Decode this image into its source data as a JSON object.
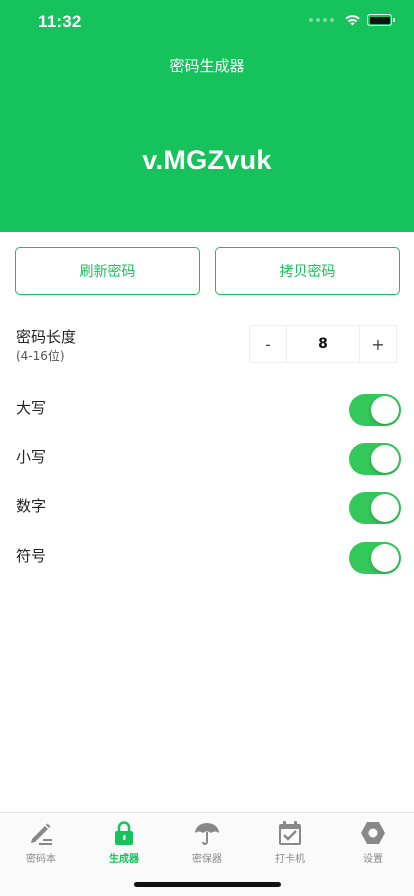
{
  "status_bar": {
    "time": "11:32"
  },
  "header": {
    "title": "密码生成器",
    "password": "v.MGZvuk",
    "bg_color": "#15c25c"
  },
  "actions": {
    "refresh_label": "刷新密码",
    "copy_label": "拷贝密码"
  },
  "length": {
    "label": "密码长度",
    "range": "(4-16位)",
    "minus": "-",
    "value": "8",
    "plus": "+"
  },
  "options": [
    {
      "label": "大写",
      "enabled": true
    },
    {
      "label": "小写",
      "enabled": true
    },
    {
      "label": "数字",
      "enabled": true
    },
    {
      "label": "符号",
      "enabled": true
    }
  ],
  "tabbar": [
    {
      "label": "密码本",
      "icon": "pen-icon",
      "active": false
    },
    {
      "label": "生成器",
      "icon": "lock-icon",
      "active": true
    },
    {
      "label": "密保器",
      "icon": "umbrella-icon",
      "active": false
    },
    {
      "label": "打卡机",
      "icon": "calendar-check-icon",
      "active": false
    },
    {
      "label": "设置",
      "icon": "settings-icon",
      "active": false
    }
  ],
  "colors": {
    "accent": "#15c25c",
    "toggle_on": "#34c759",
    "inactive": "#888888"
  }
}
